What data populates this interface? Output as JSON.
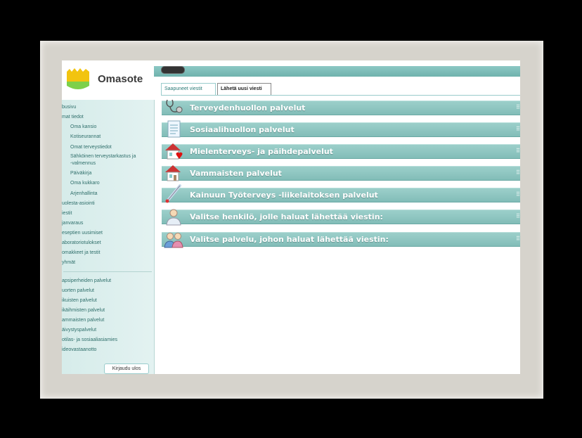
{
  "brand": {
    "name": "Omasote"
  },
  "tabs": [
    {
      "label": "Saapuneet viestit"
    },
    {
      "label": "Lähetä uusi viesti"
    }
  ],
  "sidebar": {
    "items": [
      {
        "label": "busivu"
      },
      {
        "label": "mat tiedot"
      },
      {
        "label": "Oma kansio"
      },
      {
        "label": "Kotiseurannat"
      },
      {
        "label": "Omat terveystiedot"
      },
      {
        "label": "Sähköinen terveystarkastus ja"
      },
      {
        "label": "-valmennus"
      },
      {
        "label": "Päiväkirja"
      },
      {
        "label": "Oma kukkaro"
      },
      {
        "label": "Arjenhallinta"
      },
      {
        "label": "uolesta-asiointi"
      },
      {
        "label": "iestit"
      },
      {
        "label": "janvaraus"
      },
      {
        "label": "eseptien uusimiset"
      },
      {
        "label": "aboratoriotulokset"
      },
      {
        "label": "omakkeet ja testit"
      },
      {
        "label": "yhmät"
      },
      {
        "label": "apsiperheiden palvelut"
      },
      {
        "label": "uorten palvelut"
      },
      {
        "label": "ikuisten palvelut"
      },
      {
        "label": "ikäihmisten palvelut"
      },
      {
        "label": "ammaisten palvelut"
      },
      {
        "label": "äivystyspalvelut"
      },
      {
        "label": "otilas- ja sosiaaliasiamies"
      },
      {
        "label": "ideovastaanotto"
      }
    ],
    "logout": "Kirjaudu ulos"
  },
  "sections": [
    {
      "label": "Terveydenhuollon palvelut",
      "icon": "stethoscope-icon"
    },
    {
      "label": "Sosiaalihuollon palvelut",
      "icon": "document-icon"
    },
    {
      "label": "Mielenterveys- ja päihdepalvelut",
      "icon": "house-heart-icon"
    },
    {
      "label": "Vammaisten palvelut",
      "icon": "house-icon"
    },
    {
      "label": "Kainuun Työterveys -liikelaitoksen palvelut",
      "icon": "thermometer-icon"
    },
    {
      "label": "Valitse henkilö, jolle haluat lähettää viestin:",
      "icon": "person-icon"
    },
    {
      "label": "Valitse palvelu, johon haluat lähettää viestin:",
      "icon": "people-icon"
    }
  ],
  "colors": {
    "accent": "#8cc6c1",
    "sidebar": "#dcefed",
    "frame": "#d6d3cc"
  }
}
